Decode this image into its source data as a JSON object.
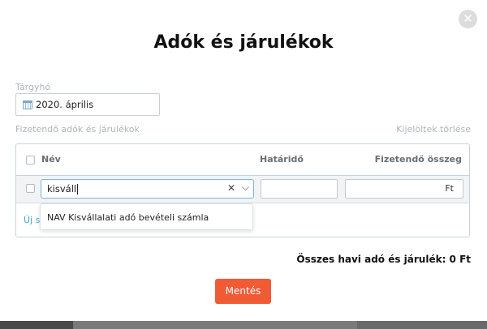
{
  "modal": {
    "title": "Adók és járulékok",
    "close_icon": "close-icon"
  },
  "subject": {
    "label": "Tárgyhó",
    "value": "2020. április",
    "icon": "calendar-icon"
  },
  "section": {
    "label": "Fizetendő adók és járulékok",
    "clear_label": "Kijelöltek törlése"
  },
  "table": {
    "columns": [
      "Név",
      "Határidő",
      "Fizetendő összeg"
    ],
    "row": {
      "name_value": "kisváll",
      "deadline_value": "",
      "amount_value": "",
      "currency": "Ft"
    },
    "new_link": "Új s"
  },
  "dropdown": {
    "options": [
      "NAV Kisvállalati adó bevételi számla"
    ]
  },
  "footer": {
    "total_label": "Összes havi adó és járulék: 0 Ft",
    "save_label": "Mentés"
  },
  "colors": {
    "accent": "#f05a35",
    "link": "#4aa5c9",
    "focus_border": "#7cb6d8"
  }
}
